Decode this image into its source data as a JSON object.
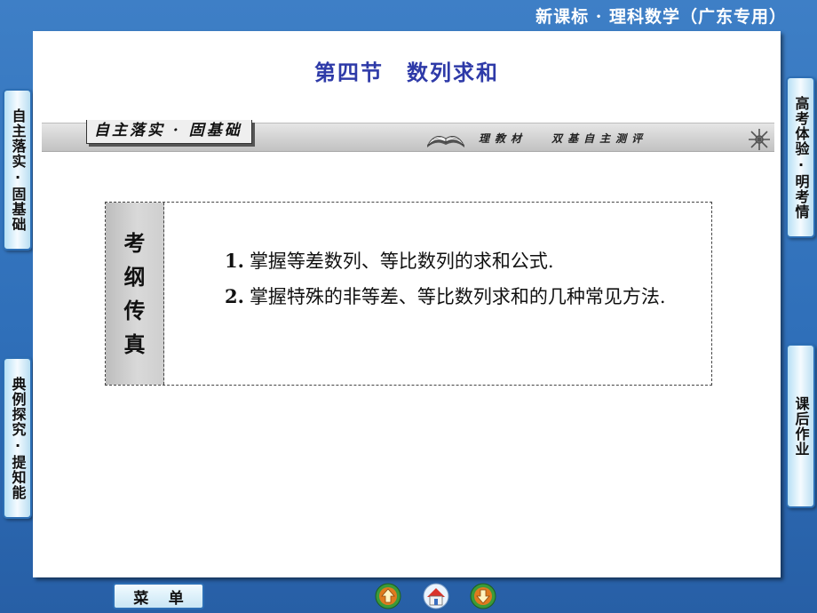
{
  "header": {
    "title": "新课标 · 理科数学（广东专用）"
  },
  "section": {
    "title": "第四节　数列求和"
  },
  "banner": {
    "tab_label": "自主落实 · 固基础",
    "subtitle": "理教材　 双基自主测评"
  },
  "syllabus": {
    "label_chars": [
      "考",
      "纲",
      "传",
      "真"
    ],
    "items": [
      {
        "num": "1.",
        "text": "掌握等差数列、等比数列的求和公式."
      },
      {
        "num": "2.",
        "text": "掌握特殊的非等差、等比数列求和的几种常见方法."
      }
    ]
  },
  "left_nav": [
    {
      "label": "自主落实·固基础"
    },
    {
      "label": "典例探究·提知能"
    }
  ],
  "right_nav": [
    {
      "label": "高考体验·明考情"
    },
    {
      "label": "课后作业"
    }
  ],
  "footer": {
    "menu_chars": [
      "菜",
      "单"
    ],
    "prev_icon": "up-arrow-icon",
    "home_icon": "home-icon",
    "next_icon": "down-arrow-icon"
  },
  "colors": {
    "background": "#3e7fc6",
    "title_blue": "#2e3aa8",
    "nav_orange": "#e07a1f",
    "nav_green": "#3a9a3a"
  }
}
